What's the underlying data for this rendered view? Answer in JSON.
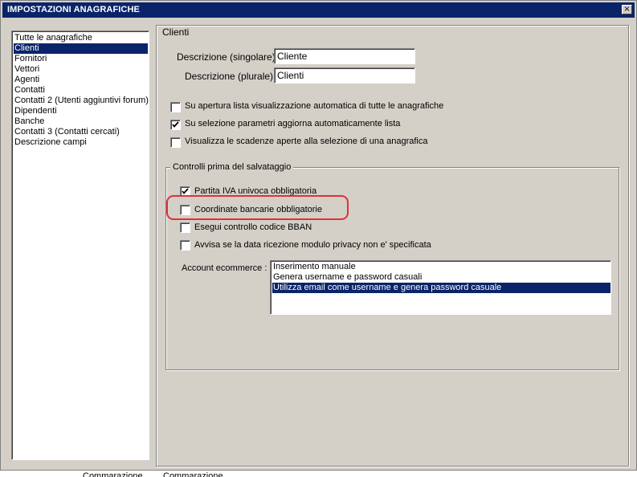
{
  "window": {
    "title": "IMPOSTAZIONI ANAGRAFICHE",
    "close_glyph": "×"
  },
  "sidebar": {
    "items": [
      {
        "label": "Tutte le anagrafiche",
        "selected": false
      },
      {
        "label": "Clienti",
        "selected": true
      },
      {
        "label": "Fornitori",
        "selected": false
      },
      {
        "label": "Vettori",
        "selected": false
      },
      {
        "label": "Agenti",
        "selected": false
      },
      {
        "label": "Contatti",
        "selected": false
      },
      {
        "label": "Contatti 2 (Utenti aggiuntivi forum)",
        "selected": false
      },
      {
        "label": "Dipendenti",
        "selected": false
      },
      {
        "label": "Banche",
        "selected": false
      },
      {
        "label": "Contatti 3 (Contatti cercati)",
        "selected": false
      },
      {
        "label": "Descrizione campi",
        "selected": false
      }
    ]
  },
  "panel": {
    "title": "Clienti",
    "desc_singolare_label": "Descrizione (singolare) :",
    "desc_singolare_value": "Cliente",
    "desc_plurale_label": "Descrizione (plurale) :",
    "desc_plurale_value": "Clienti",
    "options": [
      {
        "label": "Su apertura lista visualizzazione automatica di tutte le anagrafiche",
        "checked": false
      },
      {
        "label": "Su selezione parametri aggiorna automaticamente lista",
        "checked": true
      },
      {
        "label": "Visualizza le scadenze aperte alla selezione di una anagrafica",
        "checked": false
      }
    ]
  },
  "checks_group": {
    "title": "Controlli prima del salvataggio",
    "options": [
      {
        "label": "Partita IVA univoca obbligatoria",
        "checked": true
      },
      {
        "label": "Coordinate bancarie obbligatorie",
        "checked": false
      },
      {
        "label": "Esegui controllo codice BBAN",
        "checked": false
      },
      {
        "label": "Avvisa se la data ricezione modulo privacy non e' specificata",
        "checked": false
      }
    ],
    "account_label": "Account ecommerce :",
    "account_options": [
      {
        "label": "Inserimento manuale",
        "selected": false
      },
      {
        "label": "Genera username e password casuali",
        "selected": false
      },
      {
        "label": "Utilizza email come username e genera password casuale",
        "selected": true
      }
    ]
  },
  "background": {
    "text_left": "Commarazione",
    "text_right": "Commarazione"
  },
  "colors": {
    "titlebar": "#0a246a",
    "selection": "#0a246a",
    "highlight_ring": "#e0303a",
    "window_face": "#d4d0c8"
  }
}
